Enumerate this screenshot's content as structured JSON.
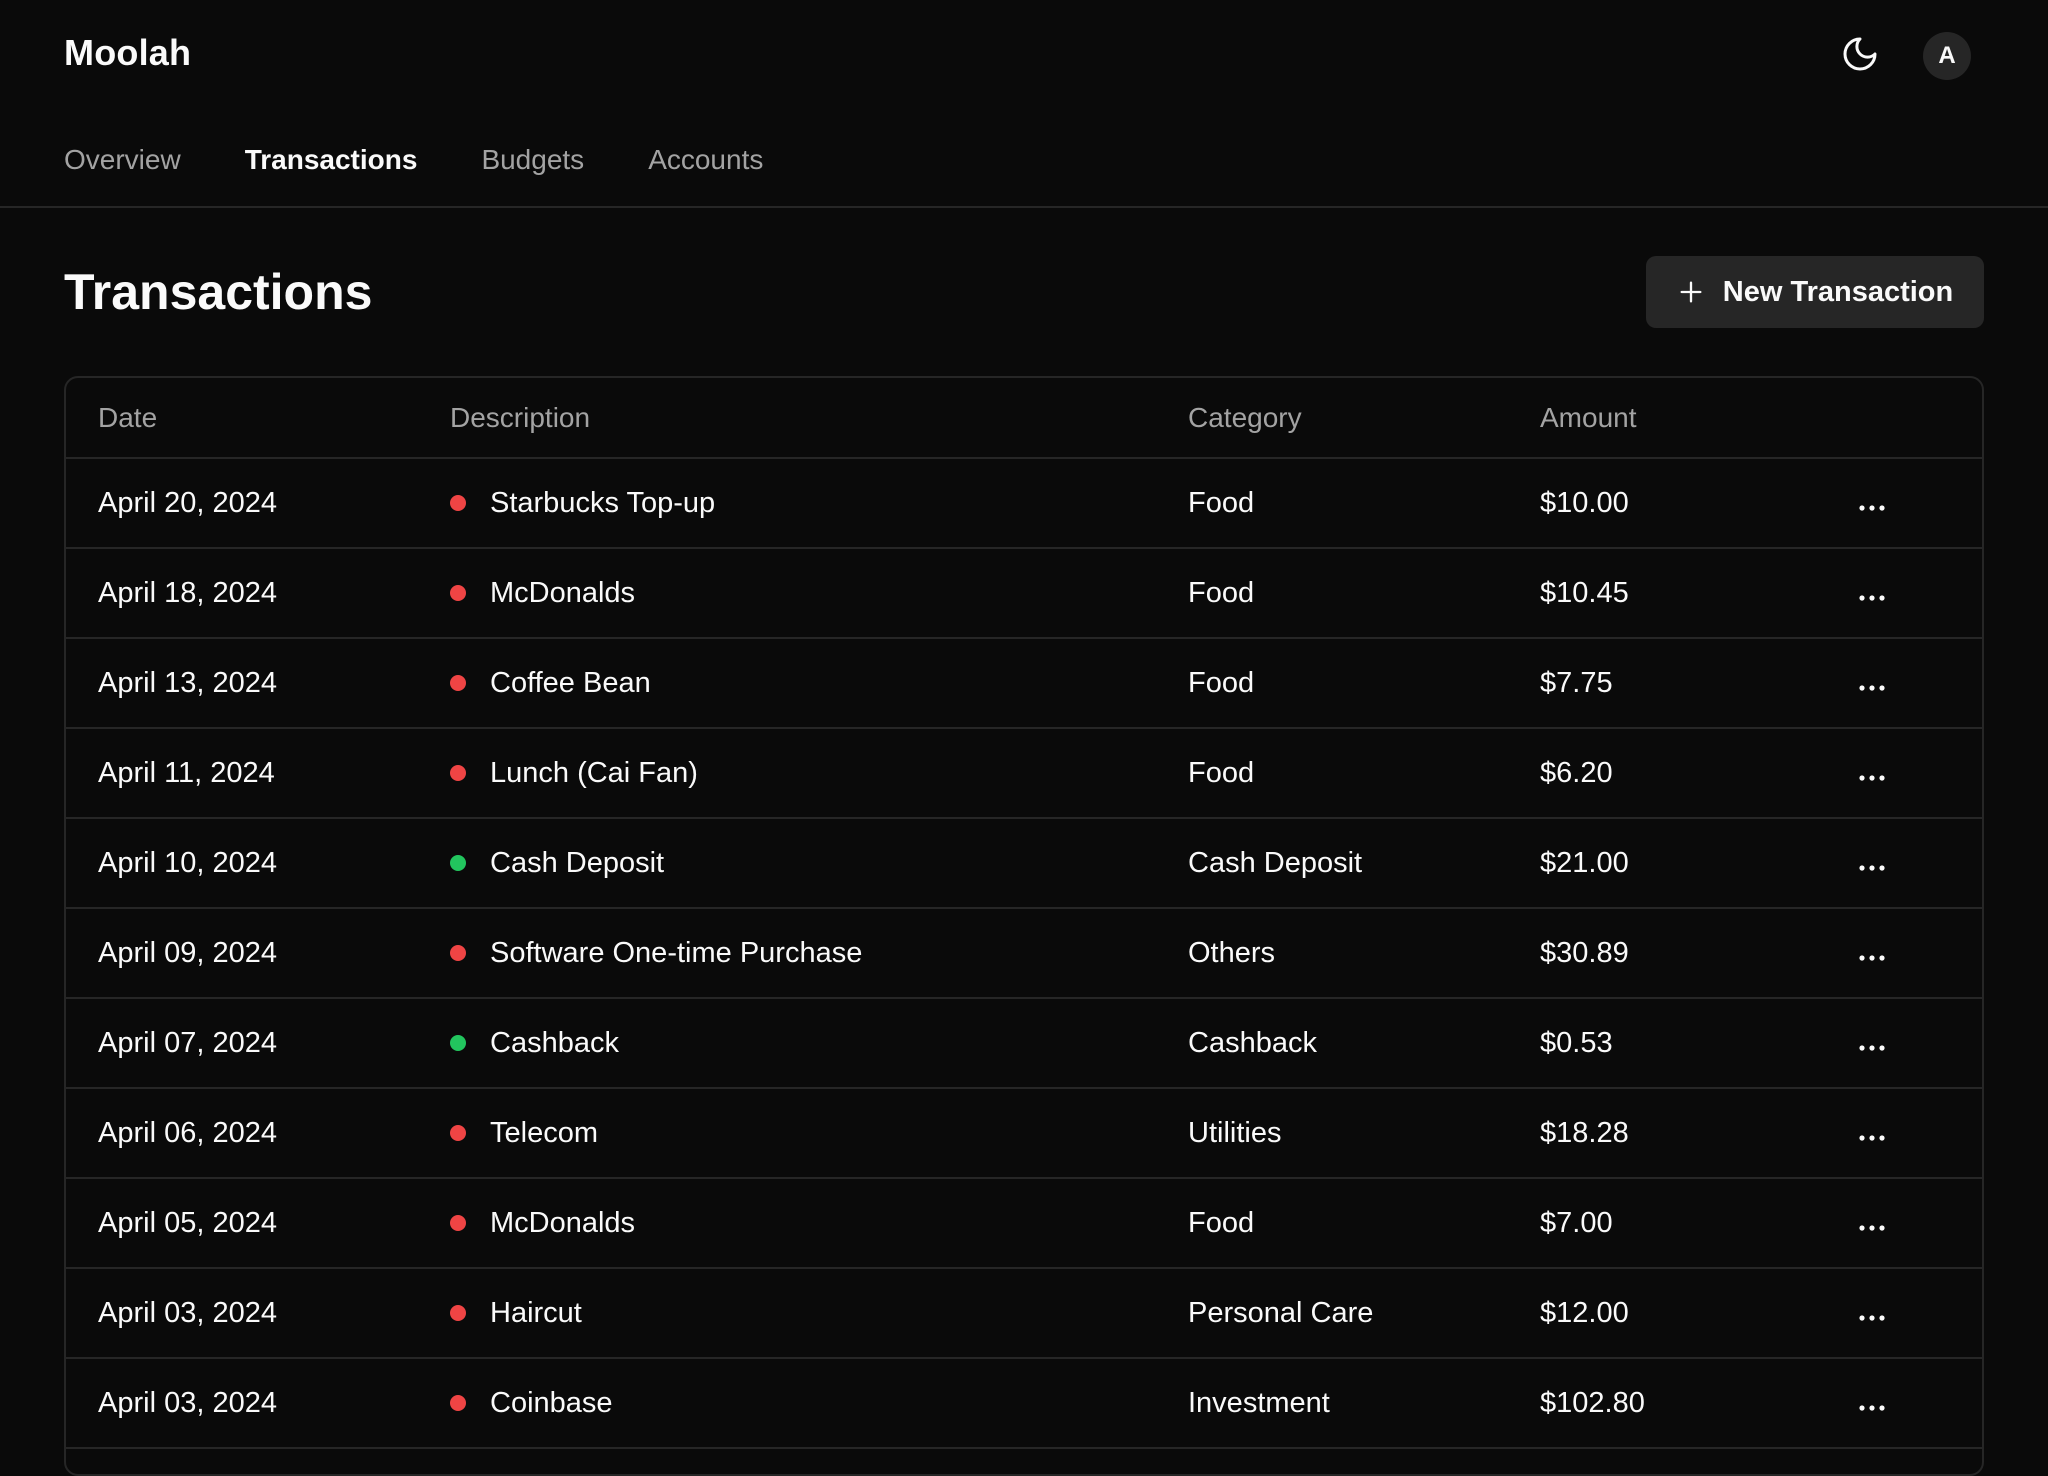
{
  "app": {
    "name": "Moolah",
    "avatar_initial": "A"
  },
  "nav": {
    "items": [
      {
        "label": "Overview",
        "active": false
      },
      {
        "label": "Transactions",
        "active": true
      },
      {
        "label": "Budgets",
        "active": false
      },
      {
        "label": "Accounts",
        "active": false
      }
    ]
  },
  "page": {
    "title": "Transactions",
    "new_button_label": "New Transaction"
  },
  "icons": {
    "theme_toggle": "moon-icon",
    "new_button": "plus-icon",
    "row_action": "more-horizontal-icon"
  },
  "colors": {
    "expense": "#ef4444",
    "income": "#22c55e",
    "background": "#0a0a0a",
    "button_bg": "#262626"
  },
  "table": {
    "headers": {
      "date": "Date",
      "description": "Description",
      "category": "Category",
      "amount": "Amount"
    },
    "rows": [
      {
        "date": "April 20, 2024",
        "description": "Starbucks Top-up",
        "category": "Food",
        "amount": "$10.00",
        "type": "expense"
      },
      {
        "date": "April 18, 2024",
        "description": "McDonalds",
        "category": "Food",
        "amount": "$10.45",
        "type": "expense"
      },
      {
        "date": "April 13, 2024",
        "description": "Coffee Bean",
        "category": "Food",
        "amount": "$7.75",
        "type": "expense"
      },
      {
        "date": "April 11, 2024",
        "description": "Lunch (Cai Fan)",
        "category": "Food",
        "amount": "$6.20",
        "type": "expense"
      },
      {
        "date": "April 10, 2024",
        "description": "Cash Deposit",
        "category": "Cash Deposit",
        "amount": "$21.00",
        "type": "income"
      },
      {
        "date": "April 09, 2024",
        "description": "Software One-time Purchase",
        "category": "Others",
        "amount": "$30.89",
        "type": "expense"
      },
      {
        "date": "April 07, 2024",
        "description": "Cashback",
        "category": "Cashback",
        "amount": "$0.53",
        "type": "income"
      },
      {
        "date": "April 06, 2024",
        "description": "Telecom",
        "category": "Utilities",
        "amount": "$18.28",
        "type": "expense"
      },
      {
        "date": "April 05, 2024",
        "description": "McDonalds",
        "category": "Food",
        "amount": "$7.00",
        "type": "expense"
      },
      {
        "date": "April 03, 2024",
        "description": "Haircut",
        "category": "Personal Care",
        "amount": "$12.00",
        "type": "expense"
      },
      {
        "date": "April 03, 2024",
        "description": "Coinbase",
        "category": "Investment",
        "amount": "$102.80",
        "type": "expense"
      }
    ]
  }
}
